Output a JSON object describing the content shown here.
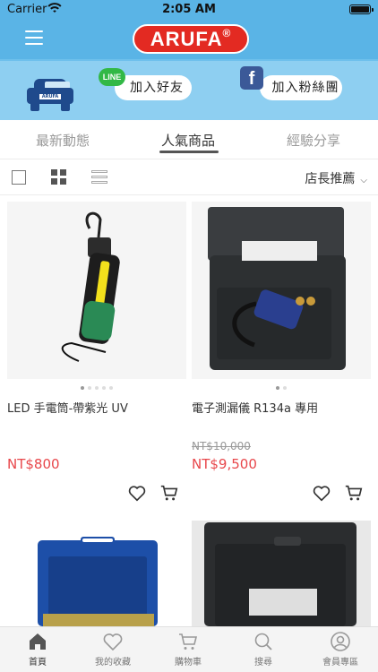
{
  "status_bar": {
    "carrier": "Carrier",
    "time": "2:05 AM"
  },
  "header": {
    "logo_text": "ARUFA",
    "logo_mark": "®"
  },
  "banner": {
    "car_plate": "ARUFA",
    "line_badge": "LINE",
    "line_button": "加入好友",
    "fb_badge": "f",
    "fb_button": "加入粉絲團"
  },
  "tabs": [
    {
      "label": "最新動態",
      "active": false
    },
    {
      "label": "人氣商品",
      "active": true
    },
    {
      "label": "經驗分享",
      "active": false
    }
  ],
  "toolbar": {
    "sort_label": "店長推薦"
  },
  "products": [
    {
      "name": "LED 手電筒-帶紫光 UV",
      "original_price": "",
      "price": "NT$800",
      "image": "led-flashlight"
    },
    {
      "name": "電子測漏儀 R134a 專用",
      "original_price": "NT$10,000",
      "price": "NT$9,500",
      "image": "leak-detector-case"
    },
    {
      "name": "",
      "original_price": "",
      "price": "",
      "image": "blue-tool-case"
    },
    {
      "name": "",
      "original_price": "",
      "price": "",
      "image": "black-tool-case"
    }
  ],
  "bottom_nav": [
    {
      "label": "首頁",
      "icon": "home-icon",
      "active": true
    },
    {
      "label": "我的收藏",
      "icon": "heart-icon",
      "active": false
    },
    {
      "label": "購物車",
      "icon": "cart-icon",
      "active": false
    },
    {
      "label": "搜尋",
      "icon": "search-icon",
      "active": false
    },
    {
      "label": "會員專區",
      "icon": "user-icon",
      "active": false
    }
  ],
  "colors": {
    "header": "#5ab4e6",
    "banner": "#8ecff1",
    "logo": "#e32a22",
    "price": "#e8474b"
  }
}
